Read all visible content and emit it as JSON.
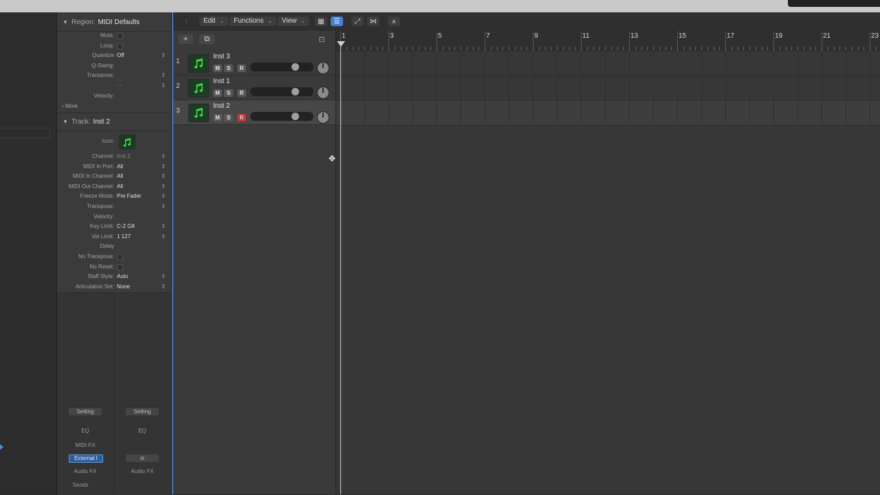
{
  "inspector": {
    "region": {
      "label": "Region:",
      "name": "MIDI Defaults",
      "rows": [
        {
          "key": "Mute:",
          "type": "check"
        },
        {
          "key": "Loop:",
          "type": "check"
        },
        {
          "key": "Quantize",
          "value": "Off"
        },
        {
          "key": "Q-Swing:",
          "value": ""
        },
        {
          "key": "Transpose:",
          "value": ""
        },
        {
          "key": "",
          "value": "- -"
        },
        {
          "key": "Velocity:",
          "value": ""
        }
      ],
      "more": "More"
    },
    "track": {
      "label": "Track:",
      "name": "Inst 2",
      "icon_label": "Icon:",
      "rows": [
        {
          "key": "Channel:",
          "value": "Inst 2"
        },
        {
          "key": "MIDI In Port:",
          "value": "All"
        },
        {
          "key": "MIDI In Channel:",
          "value": "All"
        },
        {
          "key": "MIDI Out Channel:",
          "value": "All"
        },
        {
          "key": "Freeze Mode:",
          "value": "Pre Fader"
        },
        {
          "key": "Transpose:",
          "value": ""
        },
        {
          "key": "Velocity:",
          "value": ""
        },
        {
          "key": "Key Limit:",
          "value": "C-2  G8"
        },
        {
          "key": "Vel Limit:",
          "value": "1  127"
        },
        {
          "key": "Delay",
          "value": ""
        },
        {
          "key": "No Transpose:",
          "type": "check"
        },
        {
          "key": "No Reset:",
          "type": "check"
        },
        {
          "key": "Staff Style:",
          "value": "Auto"
        },
        {
          "key": "Articulation Set:",
          "value": "None"
        }
      ]
    },
    "strips": {
      "left": {
        "setting": "Setting",
        "eq": "EQ",
        "midi_fx": "MIDI FX",
        "input": "External I",
        "audio_fx": "Audio FX",
        "sends": "Sends"
      },
      "right": {
        "setting": "Setting",
        "eq": "EQ",
        "link": "⊖",
        "audio_fx": "Audio FX"
      }
    }
  },
  "toolbar": {
    "edit": "Edit",
    "functions": "Functions",
    "view": "View"
  },
  "tracks": [
    {
      "num": "1",
      "name": "Inst 3",
      "m": "M",
      "s": "S",
      "r": "R",
      "armed": false
    },
    {
      "num": "2",
      "name": "Inst 1",
      "m": "M",
      "s": "S",
      "r": "R",
      "armed": false
    },
    {
      "num": "3",
      "name": "Inst 2",
      "m": "M",
      "s": "S",
      "r": "R",
      "armed": true
    }
  ],
  "ruler": {
    "bars": [
      "1",
      "3",
      "5",
      "7",
      "9",
      "11",
      "13",
      "15",
      "17",
      "19",
      "21",
      "23"
    ]
  },
  "colors": {
    "accent": "#4a7fd0",
    "record": "#c0363e",
    "icon_green": "#3fd84a"
  }
}
